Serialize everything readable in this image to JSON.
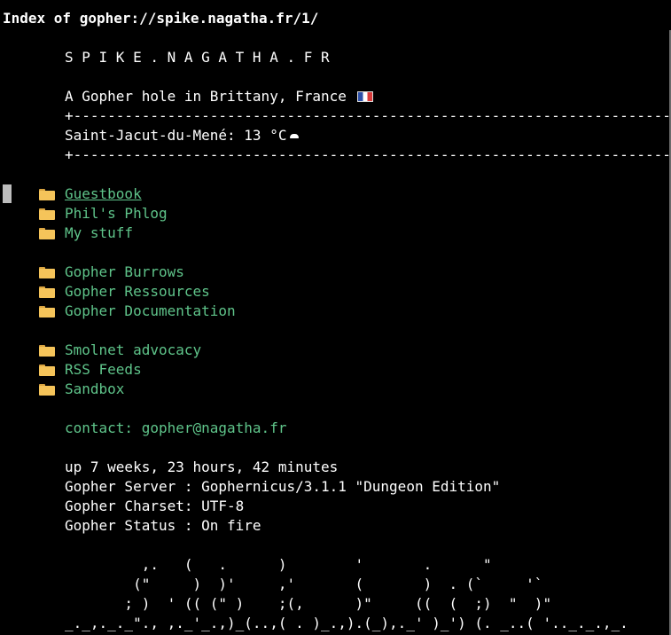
{
  "window": {
    "title": "Index of gopher://spike.nagatha.fr/1/"
  },
  "header": {
    "site_name": "S P I K E . N A G A T H A . F R",
    "tagline": "A Gopher hole in Brittany, France",
    "divider": "+-----------------------------------------------------------------------+",
    "weather": "Saint-Jacut-du-Mené: 13 °C"
  },
  "icons": {
    "flag": "france-flag-icon",
    "weather": "cloud-icon",
    "menu_item": "folder-icon"
  },
  "menu": {
    "groups": [
      {
        "items": [
          {
            "label": "Guestbook"
          },
          {
            "label": "Phil's Phlog"
          },
          {
            "label": "My stuff"
          }
        ]
      },
      {
        "items": [
          {
            "label": "Gopher Burrows"
          },
          {
            "label": "Gopher Ressources"
          },
          {
            "label": "Gopher Documentation"
          }
        ]
      },
      {
        "items": [
          {
            "label": "Smolnet advocacy"
          },
          {
            "label": "RSS Feeds"
          },
          {
            "label": "Sandbox"
          }
        ]
      }
    ]
  },
  "contact": {
    "text": "contact: gopher@nagatha.fr"
  },
  "server_info": {
    "uptime": "up 7 weeks, 23 hours, 42 minutes",
    "server": "Gopher Server : Gophernicus/3.1.1 \"Dungeon Edition\"",
    "charset": "Gopher Charset: UTF-8",
    "status": "Gopher Status : On fire"
  },
  "ascii_art": {
    "lines": [
      "         ,.   (   .      )        '       .      \"",
      "        (\"     )  )'     ,'       (       )  . (`     '`",
      "       ; )  ' (( (\" )    ;(,      )\"     ((  (  ;)  \"  )\"",
      "_._,._._\"., ,._'_.,)_(..,( . )_.,).(_),._' )_') (. _..( '.._._.,_."
    ]
  },
  "colors": {
    "background": "#000000",
    "text": "#ffffff",
    "link": "#5fc48a",
    "folder": "#f5c45a"
  }
}
